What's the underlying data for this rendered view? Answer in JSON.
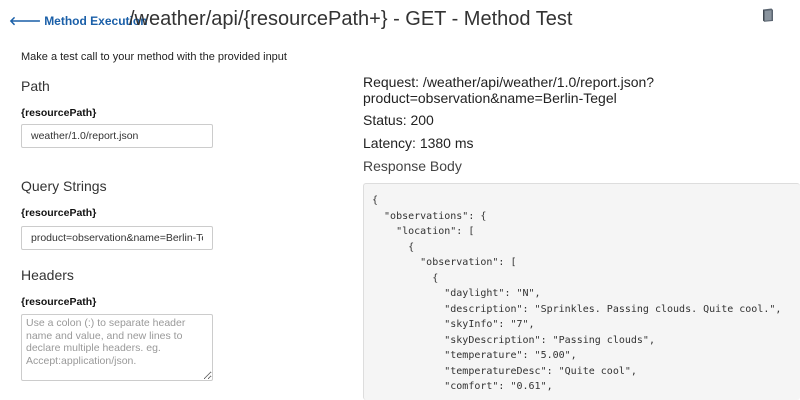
{
  "header": {
    "back_label": "Method Execution",
    "title": "/weather/api/{resourcePath+} - GET - Method Test",
    "docs_icon": "book-icon"
  },
  "intro": "Make a test call to your method with the provided input",
  "path": {
    "title": "Path",
    "label": "{resourcePath}",
    "value": "weather/1.0/report.json"
  },
  "query": {
    "title": "Query Strings",
    "label": "{resourcePath}",
    "value": "product=observation&name=Berlin-Tegel"
  },
  "headers": {
    "title": "Headers",
    "label": "{resourcePath}",
    "placeholder": "Use a colon (:) to separate header name and value, and new lines to declare multiple headers. eg. Accept:application/json."
  },
  "response": {
    "request_line1": "Request: /weather/api/weather/1.0/report.json?",
    "request_line2": "product=observation&name=Berlin-Tegel",
    "status": "Status: 200",
    "latency": "Latency: 1380 ms",
    "body_title": "Response Body",
    "body": "{\n  \"observations\": {\n    \"location\": [\n      {\n        \"observation\": [\n          {\n            \"daylight\": \"N\",\n            \"description\": \"Sprinkles. Passing clouds. Quite cool.\",\n            \"skyInfo\": \"7\",\n            \"skyDescription\": \"Passing clouds\",\n            \"temperature\": \"5.00\",\n            \"temperatureDesc\": \"Quite cool\",\n            \"comfort\": \"0.61\","
  }
}
